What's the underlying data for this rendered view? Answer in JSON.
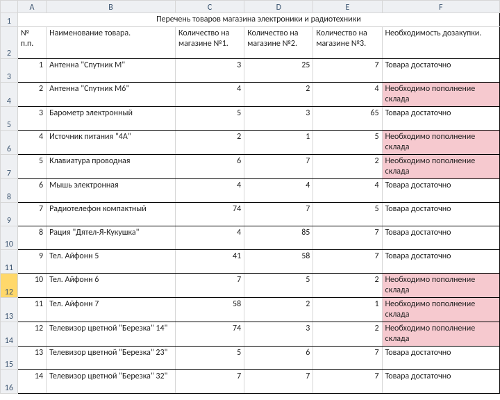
{
  "columns": [
    "A",
    "B",
    "C",
    "D",
    "E",
    "F"
  ],
  "row_labels": [
    "1",
    "2",
    "3",
    "4",
    "5",
    "6",
    "7",
    "8",
    "9",
    "10",
    "11",
    "12",
    "13",
    "14",
    "15",
    "16"
  ],
  "active_row_index": 11,
  "title": "Перечень товаров магазина электроники и радиотехники",
  "headers": {
    "A": "№ п.п.",
    "B": "Наименование товара.",
    "C": "Количество на магазине №1.",
    "D": "Количество на магазине №2.",
    "E": "Количество на магазине №3.",
    "F": "Необходимость дозакупки."
  },
  "status": {
    "ok": "Товара достаточно",
    "low": "Необходимо пополнение склада"
  },
  "rows": [
    {
      "n": 1,
      "name": "Антенна \"Спутник М\"",
      "q1": 3,
      "q2": 25,
      "q3": 7,
      "s": "ok"
    },
    {
      "n": 2,
      "name": "Антенна \"Спутник М6\"",
      "q1": 4,
      "q2": 2,
      "q3": 4,
      "s": "low"
    },
    {
      "n": 3,
      "name": "Барометр электронный",
      "q1": 5,
      "q2": 3,
      "q3": 65,
      "s": "ok"
    },
    {
      "n": 4,
      "name": "Источник питания \"4А\"",
      "q1": 2,
      "q2": 1,
      "q3": 5,
      "s": "low"
    },
    {
      "n": 5,
      "name": "Клавиатура проводная",
      "q1": 6,
      "q2": 7,
      "q3": 2,
      "s": "low"
    },
    {
      "n": 6,
      "name": "Мышь электронная",
      "q1": 4,
      "q2": 4,
      "q3": 4,
      "s": "ok"
    },
    {
      "n": 7,
      "name": "Радиотелефон компактный",
      "q1": 74,
      "q2": 7,
      "q3": 5,
      "s": "ok"
    },
    {
      "n": 8,
      "name": "Рация \"Дятел-Я-Кукушка\"",
      "q1": 4,
      "q2": 85,
      "q3": 7,
      "s": "ok"
    },
    {
      "n": 9,
      "name": "Тел. Айфонн 5",
      "q1": 41,
      "q2": 58,
      "q3": 7,
      "s": "ok"
    },
    {
      "n": 10,
      "name": "Тел. Айфонн 6",
      "q1": 7,
      "q2": 5,
      "q3": 2,
      "s": "low"
    },
    {
      "n": 11,
      "name": "Тел. Айфонн 7",
      "q1": 58,
      "q2": 2,
      "q3": 1,
      "s": "low"
    },
    {
      "n": 12,
      "name": "Телевизор цветной \"Березка\" 14\"",
      "q1": 74,
      "q2": 3,
      "q3": 2,
      "s": "low"
    },
    {
      "n": 13,
      "name": "Телевизор цветной \"Березка\" 23\"",
      "q1": 5,
      "q2": 6,
      "q3": 7,
      "s": "ok"
    },
    {
      "n": 14,
      "name": "Телевизор цветной \"Березка\" 32\"",
      "q1": 7,
      "q2": 7,
      "q3": 7,
      "s": "ok"
    }
  ]
}
